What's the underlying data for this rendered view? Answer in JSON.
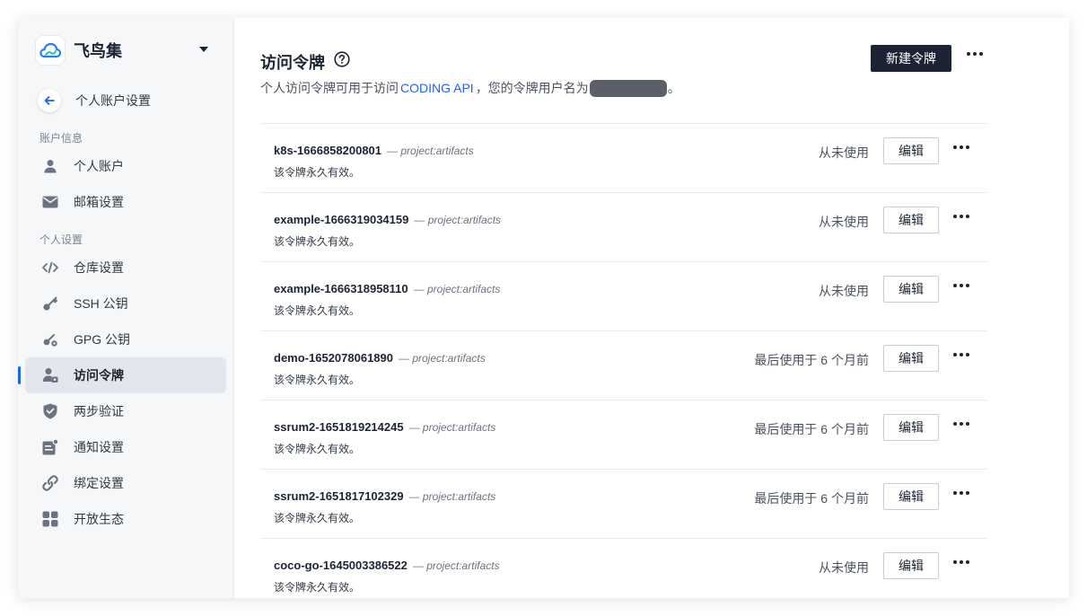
{
  "brand": {
    "name": "飞鸟集"
  },
  "back": {
    "label": "个人账户设置"
  },
  "sections": {
    "account": "账户信息",
    "personal": "个人设置"
  },
  "nav": {
    "account": [
      {
        "label": "个人账户",
        "icon": "user-icon"
      },
      {
        "label": "邮箱设置",
        "icon": "mail-icon"
      }
    ],
    "personal": [
      {
        "label": "仓库设置",
        "icon": "code-icon"
      },
      {
        "label": "SSH 公钥",
        "icon": "key-icon"
      },
      {
        "label": "GPG 公钥",
        "icon": "gpg-key-icon"
      },
      {
        "label": "访问令牌",
        "icon": "user-token-icon",
        "active": true
      },
      {
        "label": "两步验证",
        "icon": "shield-icon"
      },
      {
        "label": "通知设置",
        "icon": "notification-icon"
      },
      {
        "label": "绑定设置",
        "icon": "link-icon"
      },
      {
        "label": "开放生态",
        "icon": "apps-icon"
      }
    ]
  },
  "page": {
    "title": "访问令牌",
    "subtitle_prefix": "个人访问令牌可用于访问",
    "subtitle_link": "CODING API",
    "subtitle_middle": "，您的令牌用户名为",
    "subtitle_suffix": "。",
    "new_button": "新建令牌"
  },
  "tokens": [
    {
      "name": "k8s-1666858200801",
      "scope": "— project:artifacts",
      "expire": "该令牌永久有效。",
      "usage": "从未使用",
      "edit": "编辑"
    },
    {
      "name": "example-1666319034159",
      "scope": "— project:artifacts",
      "expire": "该令牌永久有效。",
      "usage": "从未使用",
      "edit": "编辑"
    },
    {
      "name": "example-1666318958110",
      "scope": "— project:artifacts",
      "expire": "该令牌永久有效。",
      "usage": "从未使用",
      "edit": "编辑"
    },
    {
      "name": "demo-1652078061890",
      "scope": "— project:artifacts",
      "expire": "该令牌永久有效。",
      "usage": "最后使用于 6 个月前",
      "edit": "编辑"
    },
    {
      "name": "ssrum2-1651819214245",
      "scope": "— project:artifacts",
      "expire": "该令牌永久有效。",
      "usage": "最后使用于 6 个月前",
      "edit": "编辑"
    },
    {
      "name": "ssrum2-1651817102329",
      "scope": "— project:artifacts",
      "expire": "该令牌永久有效。",
      "usage": "最后使用于 6 个月前",
      "edit": "编辑"
    },
    {
      "name": "coco-go-1645003386522",
      "scope": "— project:artifacts",
      "expire": "该令牌永久有效。",
      "usage": "从未使用",
      "edit": "编辑"
    }
  ],
  "colors": {
    "accent": "#1f64e8",
    "primary_button": "#1c2433"
  }
}
